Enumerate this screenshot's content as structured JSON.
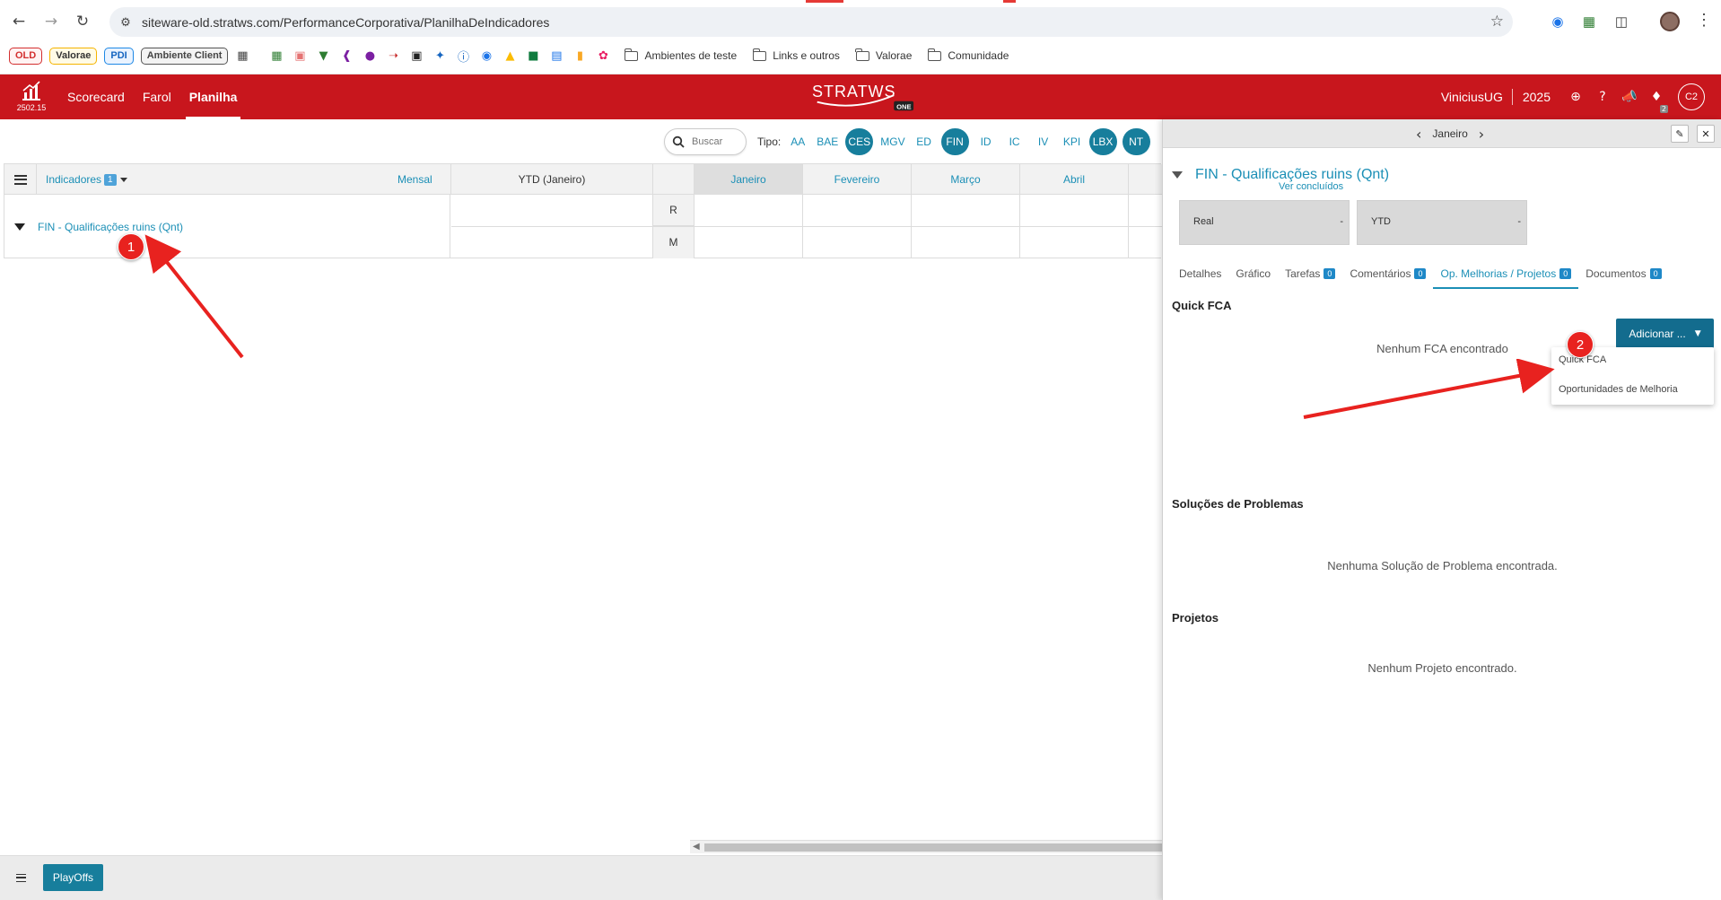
{
  "browser": {
    "url": "siteware-old.stratws.com/PerformanceCorporativa/PlanilhaDeIndicadores",
    "bookmarks": {
      "old": "OLD",
      "valorae_chip": "Valorae",
      "pdi": "PDI",
      "ambiente": "Ambiente Client",
      "folders": [
        "Ambientes de teste",
        "Links e outros",
        "Valorae",
        "Comunidade"
      ]
    }
  },
  "header": {
    "version": "2502.15",
    "nav": [
      "Scorecard",
      "Farol",
      "Planilha"
    ],
    "active_nav": "Planilha",
    "brand": "STRATWS",
    "brand_sub": "ONE",
    "user": "ViniciusUG",
    "year": "2025",
    "notif_count": "2",
    "avatar": "C2"
  },
  "filter": {
    "search_placeholder": "Buscar",
    "type_label": "Tipo:",
    "types": [
      {
        "label": "AA",
        "on": false
      },
      {
        "label": "BAE",
        "on": false
      },
      {
        "label": "CES",
        "on": true
      },
      {
        "label": "MGV",
        "on": false
      },
      {
        "label": "ED",
        "on": false
      },
      {
        "label": "FIN",
        "on": true
      },
      {
        "label": "ID",
        "on": false
      },
      {
        "label": "IC",
        "on": false
      },
      {
        "label": "IV",
        "on": false
      },
      {
        "label": "KPI",
        "on": false
      },
      {
        "label": "LBX",
        "on": true
      },
      {
        "label": "NT",
        "on": true
      }
    ]
  },
  "grid": {
    "indicators_label": "Indicadores",
    "indicators_count": "1",
    "period": "Mensal",
    "ytd": "YTD (Janeiro)",
    "months": [
      "Janeiro",
      "Fevereiro",
      "Março",
      "Abril"
    ],
    "row_name": "FIN - Qualificações ruins (Qnt)",
    "row_r": "R",
    "row_m": "M"
  },
  "annotations": [
    "1",
    "2"
  ],
  "bottom": {
    "playoffs": "PlayOffs"
  },
  "panel": {
    "month": "Janeiro",
    "title": "FIN - Qualificações ruins (Qnt)",
    "real_label": "Real",
    "real_value": "-",
    "ytd_label": "YTD",
    "ytd_value": "-",
    "tabs": [
      {
        "label": "Detalhes",
        "count": null
      },
      {
        "label": "Gráfico",
        "count": null
      },
      {
        "label": "Tarefas",
        "count": "0"
      },
      {
        "label": "Comentários",
        "count": "0"
      },
      {
        "label": "Op. Melhorias / Projetos",
        "count": "0"
      },
      {
        "label": "Documentos",
        "count": "0"
      }
    ],
    "add_button": "Adicionar ...",
    "dropdown": [
      "Quick FCA",
      "Oportunidades de Melhoria"
    ],
    "quick_fca_title": "Quick FCA",
    "ver_concluidos": "Ver concluídos",
    "no_fca": "Nenhum FCA encontrado",
    "solucoes_title": "Soluções de Problemas",
    "no_solucao": "Nenhuma Solução de Problema encontrada.",
    "projetos_title": "Projetos",
    "no_projeto": "Nenhum Projeto encontrado."
  },
  "colors": {
    "header_red": "#c8161d",
    "accent_teal": "#177e9c",
    "link_blue": "#1b8fb6",
    "annotation_red": "#e8221f"
  }
}
